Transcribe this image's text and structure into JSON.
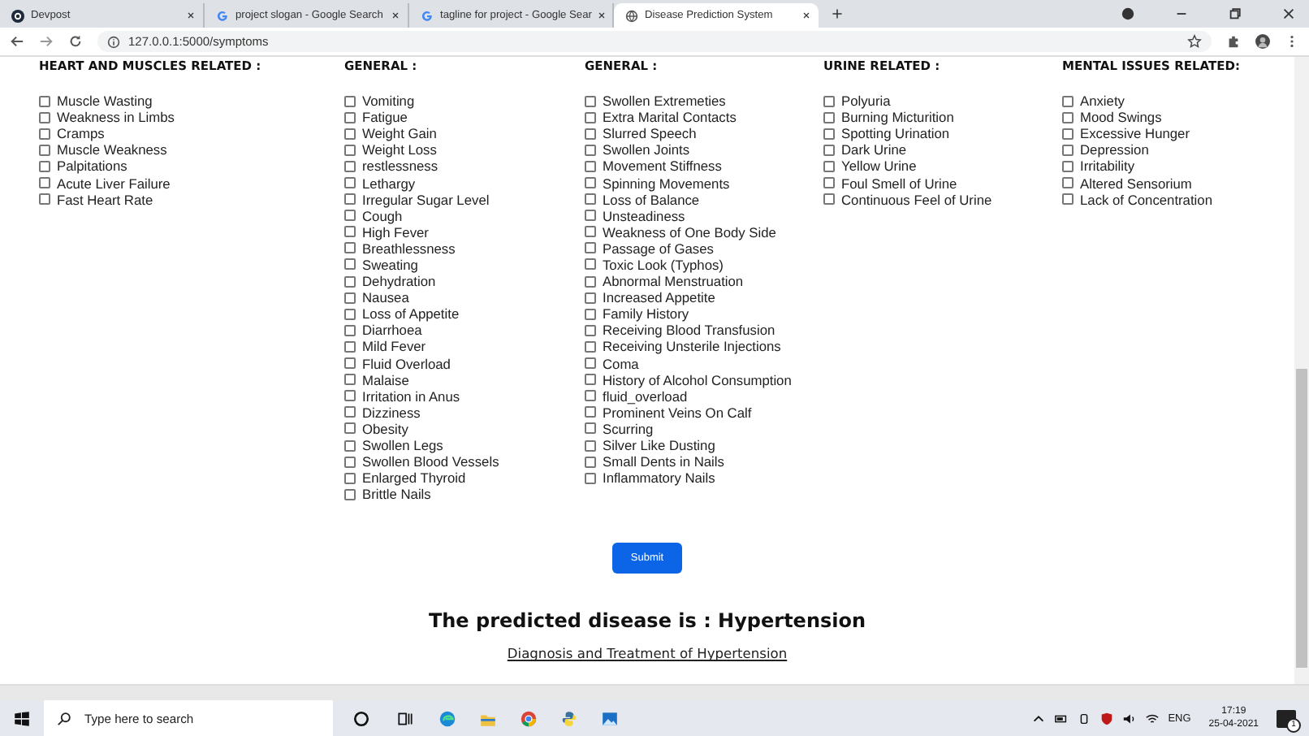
{
  "browser": {
    "tabs": [
      {
        "label": "Devpost",
        "selected": false
      },
      {
        "label": "project slogan - Google Search",
        "selected": false
      },
      {
        "label": "tagline for project - Google Sear",
        "selected": false
      },
      {
        "label": "Disease Prediction System",
        "selected": true
      }
    ],
    "address": "127.0.0.1:5000/symptoms"
  },
  "groups": [
    {
      "heading": "HEART AND MUSCLES RELATED :",
      "symptoms": [
        {
          "label": "Muscle Wasting",
          "checked": false
        },
        {
          "label": "Weakness in Limbs",
          "checked": false
        },
        {
          "label": "Cramps",
          "checked": false
        },
        {
          "label": "Muscle Weakness",
          "checked": false
        },
        {
          "label": "Palpitations",
          "checked": false
        },
        {
          "label": "Acute Liver Failure",
          "checked": false
        },
        {
          "label": "Fast Heart Rate",
          "checked": false
        }
      ]
    },
    {
      "heading": "GENERAL :",
      "symptoms": [
        {
          "label": "Vomiting",
          "checked": false
        },
        {
          "label": "Fatigue",
          "checked": false
        },
        {
          "label": "Weight Gain",
          "checked": false
        },
        {
          "label": "Weight Loss",
          "checked": false
        },
        {
          "label": "restlessness",
          "checked": false
        },
        {
          "label": "Lethargy",
          "checked": false
        },
        {
          "label": "Irregular Sugar Level",
          "checked": false
        },
        {
          "label": "Cough",
          "checked": false
        },
        {
          "label": "High Fever",
          "checked": false
        },
        {
          "label": "Breathlessness",
          "checked": false
        },
        {
          "label": "Sweating",
          "checked": false
        },
        {
          "label": "Dehydration",
          "checked": false
        },
        {
          "label": "Nausea",
          "checked": false
        },
        {
          "label": "Loss of Appetite",
          "checked": false
        },
        {
          "label": "Diarrhoea",
          "checked": false
        },
        {
          "label": "Mild Fever",
          "checked": false
        },
        {
          "label": "Fluid Overload",
          "checked": false
        },
        {
          "label": "Malaise",
          "checked": false
        },
        {
          "label": "Irritation in Anus",
          "checked": false
        },
        {
          "label": "Dizziness",
          "checked": false
        },
        {
          "label": "Obesity",
          "checked": false
        },
        {
          "label": "Swollen Legs",
          "checked": false
        },
        {
          "label": "Swollen Blood Vessels",
          "checked": false
        },
        {
          "label": "Enlarged Thyroid",
          "checked": false
        },
        {
          "label": "Brittle Nails",
          "checked": false
        }
      ]
    },
    {
      "heading": "GENERAL :",
      "symptoms": [
        {
          "label": "Swollen Extremeties",
          "checked": false
        },
        {
          "label": "Extra Marital Contacts",
          "checked": false
        },
        {
          "label": "Slurred Speech",
          "checked": false
        },
        {
          "label": "Swollen Joints",
          "checked": false
        },
        {
          "label": "Movement Stiffness",
          "checked": false
        },
        {
          "label": "Spinning Movements",
          "checked": false
        },
        {
          "label": "Loss of Balance",
          "checked": false
        },
        {
          "label": "Unsteadiness",
          "checked": false
        },
        {
          "label": "Weakness of One Body Side",
          "checked": false
        },
        {
          "label": "Passage of Gases",
          "checked": false
        },
        {
          "label": "Toxic Look (Typhos)",
          "checked": false
        },
        {
          "label": "Abnormal Menstruation",
          "checked": false
        },
        {
          "label": "Increased Appetite",
          "checked": false
        },
        {
          "label": "Family History",
          "checked": false
        },
        {
          "label": "Receiving Blood Transfusion",
          "checked": false
        },
        {
          "label": "Receiving Unsterile Injections",
          "checked": false
        },
        {
          "label": "Coma",
          "checked": false
        },
        {
          "label": "History of Alcohol Consumption",
          "checked": false
        },
        {
          "label": "fluid_overload",
          "checked": false
        },
        {
          "label": "Prominent Veins On Calf",
          "checked": false
        },
        {
          "label": "Scurring",
          "checked": false
        },
        {
          "label": "Silver Like Dusting",
          "checked": false
        },
        {
          "label": "Small Dents in Nails",
          "checked": false
        },
        {
          "label": "Inflammatory Nails",
          "checked": false
        }
      ]
    },
    {
      "heading": "URINE RELATED :",
      "symptoms": [
        {
          "label": "Polyuria",
          "checked": false
        },
        {
          "label": "Burning Micturition",
          "checked": false
        },
        {
          "label": "Spotting Urination",
          "checked": false
        },
        {
          "label": "Dark Urine",
          "checked": false
        },
        {
          "label": "Yellow Urine",
          "checked": false
        },
        {
          "label": "Foul Smell of Urine",
          "checked": false
        },
        {
          "label": "Continuous Feel of Urine",
          "checked": false
        }
      ]
    },
    {
      "heading": "MENTAL ISSUES RELATED:",
      "symptoms": [
        {
          "label": "Anxiety",
          "checked": false
        },
        {
          "label": "Mood Swings",
          "checked": false
        },
        {
          "label": "Excessive Hunger",
          "checked": false
        },
        {
          "label": "Depression",
          "checked": false
        },
        {
          "label": "Irritability",
          "checked": false
        },
        {
          "label": "Altered Sensorium",
          "checked": false
        },
        {
          "label": "Lack of Concentration",
          "checked": false
        }
      ]
    }
  ],
  "submit": "Submit",
  "result": "The predicted disease is : Hypertension",
  "link": "Diagnosis and Treatment of Hypertension",
  "taskbar": {
    "search_placeholder": "Type here to search",
    "language": "ENG",
    "time": "17:19",
    "date": "25-04-2021",
    "notifications": "1"
  }
}
